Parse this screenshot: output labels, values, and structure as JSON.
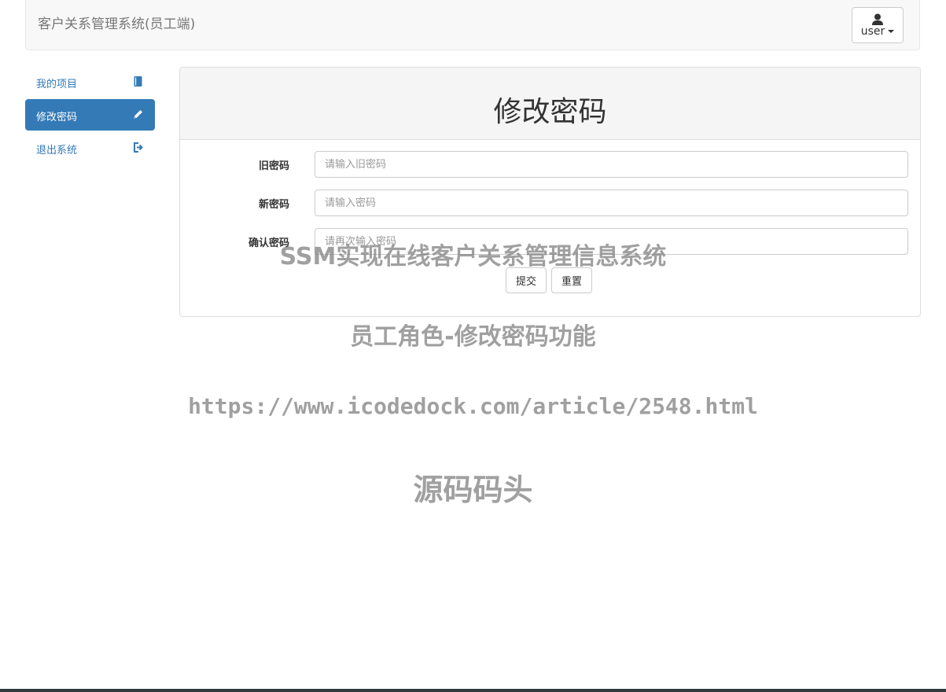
{
  "navbar": {
    "brand": "客户关系管理系统(员工端)",
    "user_label": "user"
  },
  "sidebar": {
    "items": [
      {
        "label": "我的项目",
        "icon": "book-icon",
        "active": false
      },
      {
        "label": "修改密码",
        "icon": "pencil-icon",
        "active": true
      },
      {
        "label": "退出系统",
        "icon": "logout-icon",
        "active": false
      }
    ]
  },
  "panel": {
    "title": "修改密码",
    "fields": [
      {
        "label": "旧密码",
        "placeholder": "请输入旧密码",
        "value": ""
      },
      {
        "label": "新密码",
        "placeholder": "请输入密码",
        "value": ""
      },
      {
        "label": "确认密码",
        "placeholder": "请再次输入密码",
        "value": ""
      }
    ],
    "submit_label": "提交",
    "reset_label": "重置"
  },
  "watermark": {
    "line1": "SSM实现在线客户关系管理信息系统",
    "line2": "员工角色-修改密码功能",
    "line3": "https://www.icodedock.com/article/2548.html",
    "line4": "源码码头"
  },
  "colors": {
    "accent": "#337ab7",
    "navbar_bg": "#f8f8f8",
    "panel_heading_bg": "#f5f5f5"
  }
}
